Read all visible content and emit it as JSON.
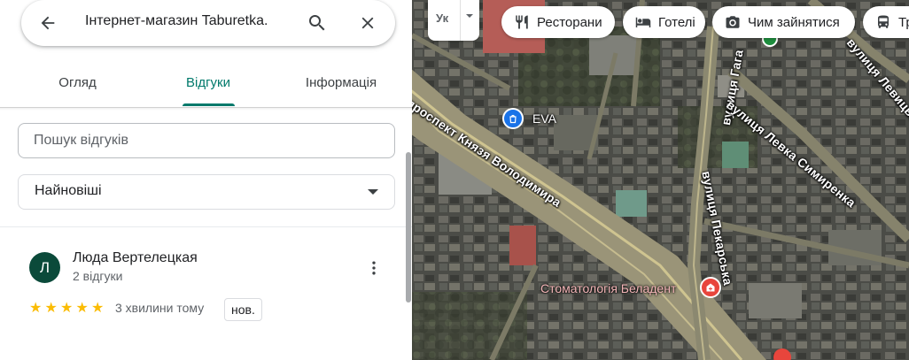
{
  "search": {
    "query": "Інтернет-магазин Taburetka."
  },
  "tabs": [
    {
      "label": "Огляд"
    },
    {
      "label": "Відгуки",
      "active": true
    },
    {
      "label": "Інформація"
    }
  ],
  "reviews_search": {
    "placeholder": "Пошук відгуків"
  },
  "sort": {
    "selected": "Найновіші"
  },
  "review": {
    "avatar_letter": "Л",
    "author": "Люда Вертелецкая",
    "author_reviews": "2 відгуки",
    "rating": 5,
    "time": "3 хвилини тому",
    "badge": "нов."
  },
  "map": {
    "layer_button": {
      "label": "Ук"
    },
    "chips": [
      {
        "label": "Ресторани",
        "icon": "fork-knife-icon"
      },
      {
        "label": "Готелі",
        "icon": "bed-icon"
      },
      {
        "label": "Чим зайнятися",
        "icon": "camera-icon"
      },
      {
        "label": "Тра",
        "icon": "bus-icon"
      }
    ],
    "streets": [
      "проспект Князя Володимира",
      "вулиця Гага",
      "вулиця Левка Симиренка",
      "вулиця Пекарська",
      "вулиця Левицького"
    ],
    "places": [
      {
        "label": "EVA",
        "icon": "shopping-bag-icon"
      },
      {
        "label": "Стоматологія Беладент",
        "icon": "dental-clinic-icon"
      }
    ]
  },
  "colors": {
    "accent": "#00796b",
    "avatar_bg": "#0b4a3a",
    "star": "#fbbc04",
    "poi_shop": "#1a73e8",
    "poi_medical": "#e8453c"
  }
}
